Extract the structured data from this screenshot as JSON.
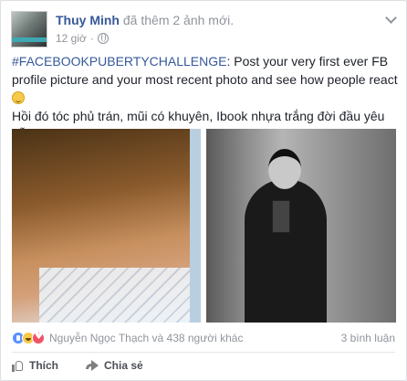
{
  "post": {
    "author": "Thuy Minh",
    "action": "đã thêm 2 ảnh mới.",
    "time": "12 giờ",
    "separator": "·",
    "privacy_icon": "globe-icon",
    "hashtag": "#FACEBOOKPUBERTYCHALLENGE",
    "text_en": ": Post your very first ever FB profile picture and your most recent photo and see how people react",
    "text_vi": "Hồi đó tóc phủ trán, mũi có khuyên, Ibook nhựa trắng đời đầu yêu dễ sợ."
  },
  "reactions": {
    "icons": [
      "like-reaction-icon",
      "haha-reaction-icon",
      "love-reaction-icon"
    ],
    "names": "Nguyễn Ngọc Thạch và 438 người khác",
    "comments": "3 bình luận"
  },
  "actions": {
    "like_label": "Thích",
    "share_label": "Chia sẻ"
  },
  "colors": {
    "link_blue": "#365899",
    "meta_gray": "#90949c",
    "like_blue": "#5890ff",
    "love_red": "#f25268"
  }
}
